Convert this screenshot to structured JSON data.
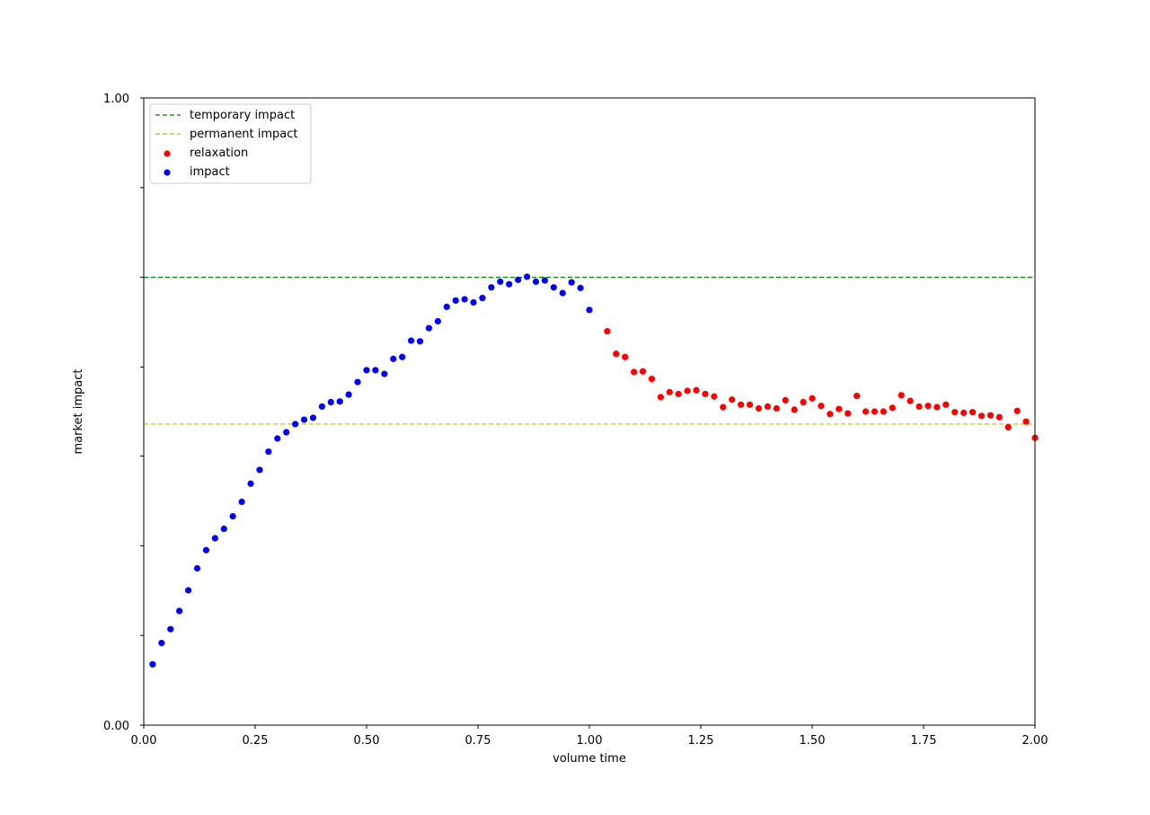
{
  "chart_data": {
    "type": "scatter",
    "title": "",
    "xlabel": "volume time",
    "ylabel": "market impact",
    "xlim": [
      0,
      2
    ],
    "ylim": [
      0,
      1
    ],
    "x_ticks": [
      "0.00",
      "0.25",
      "0.50",
      "0.75",
      "1.00",
      "1.25",
      "1.50",
      "1.75",
      "2.00"
    ],
    "y_ticks_labeled": [
      "0.00",
      "1.00"
    ],
    "y_minor_ticks": [
      0.143,
      0.286,
      0.429,
      0.571,
      0.714,
      0.857
    ],
    "grid": false,
    "legend": {
      "placement": "top-left",
      "entries": [
        "temporary impact",
        "permanent impact",
        "relaxation",
        "impact"
      ]
    },
    "reference_lines": [
      {
        "name": "temporary impact",
        "y": 0.714,
        "color": "#008000",
        "style": "dashed"
      },
      {
        "name": "permanent impact",
        "y": 0.48,
        "color": "#bfbf00",
        "style": "dashed"
      }
    ],
    "series": [
      {
        "name": "impact",
        "color": "#0000ff",
        "x": [
          0.02,
          0.04,
          0.06,
          0.08,
          0.1,
          0.12,
          0.14,
          0.16,
          0.18,
          0.2,
          0.22,
          0.24,
          0.26,
          0.28,
          0.3,
          0.32,
          0.34,
          0.36,
          0.38,
          0.4,
          0.42,
          0.44,
          0.46,
          0.48,
          0.5,
          0.52,
          0.54,
          0.56,
          0.58,
          0.6,
          0.62,
          0.64,
          0.66,
          0.68,
          0.7,
          0.72,
          0.74,
          0.76,
          0.78,
          0.8,
          0.82,
          0.84,
          0.86,
          0.88,
          0.9,
          0.92,
          0.94,
          0.96,
          0.98,
          1.0
        ],
        "y": [
          0.097,
          0.131,
          0.153,
          0.182,
          0.215,
          0.25,
          0.279,
          0.298,
          0.313,
          0.333,
          0.356,
          0.385,
          0.407,
          0.436,
          0.457,
          0.467,
          0.48,
          0.487,
          0.49,
          0.508,
          0.515,
          0.516,
          0.527,
          0.547,
          0.566,
          0.566,
          0.56,
          0.584,
          0.587,
          0.613,
          0.612,
          0.633,
          0.644,
          0.667,
          0.677,
          0.679,
          0.674,
          0.681,
          0.698,
          0.707,
          0.703,
          0.71,
          0.715,
          0.707,
          0.709,
          0.698,
          0.689,
          0.706,
          0.697,
          0.662
        ]
      },
      {
        "name": "relaxation",
        "color": "#ff0000",
        "x": [
          1.04,
          1.06,
          1.08,
          1.1,
          1.12,
          1.14,
          1.16,
          1.18,
          1.2,
          1.22,
          1.24,
          1.26,
          1.28,
          1.3,
          1.32,
          1.34,
          1.36,
          1.38,
          1.4,
          1.42,
          1.44,
          1.46,
          1.48,
          1.5,
          1.52,
          1.54,
          1.56,
          1.58,
          1.6,
          1.62,
          1.64,
          1.66,
          1.68,
          1.7,
          1.72,
          1.74,
          1.76,
          1.78,
          1.8,
          1.82,
          1.84,
          1.86,
          1.88,
          1.9,
          1.92,
          1.94,
          1.96,
          1.98,
          2.0
        ],
        "y": [
          0.628,
          0.592,
          0.587,
          0.563,
          0.564,
          0.552,
          0.523,
          0.531,
          0.528,
          0.533,
          0.534,
          0.528,
          0.524,
          0.507,
          0.519,
          0.511,
          0.511,
          0.505,
          0.508,
          0.505,
          0.518,
          0.503,
          0.515,
          0.521,
          0.509,
          0.496,
          0.504,
          0.497,
          0.525,
          0.5,
          0.5,
          0.5,
          0.506,
          0.526,
          0.517,
          0.508,
          0.509,
          0.507,
          0.511,
          0.499,
          0.498,
          0.499,
          0.493,
          0.494,
          0.491,
          0.475,
          0.501,
          0.484,
          0.458
        ]
      }
    ]
  }
}
